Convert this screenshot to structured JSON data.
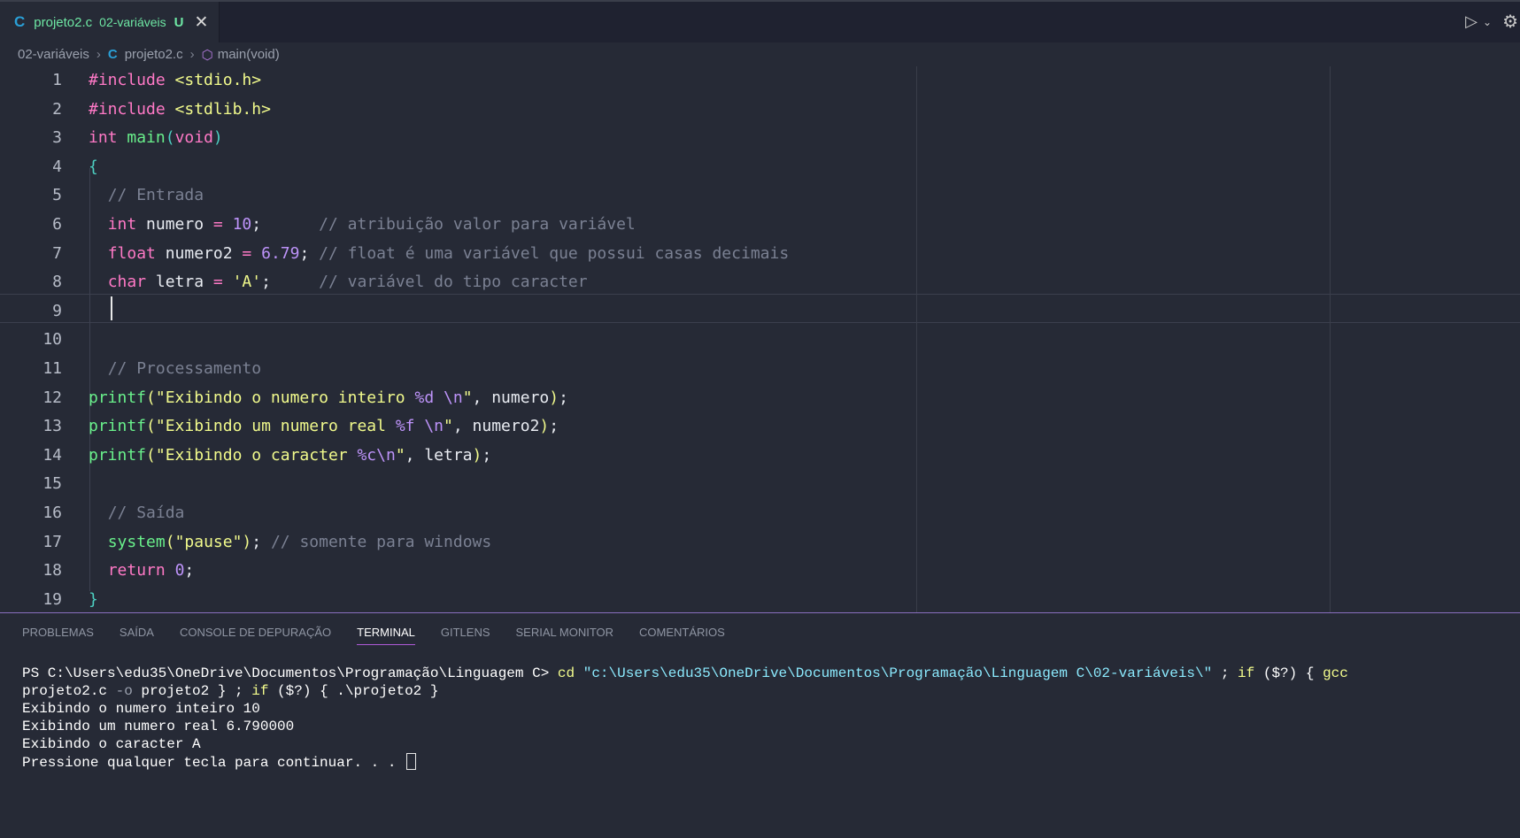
{
  "tab": {
    "icon": "C",
    "filename": "projeto2.c",
    "folder": "02-variáveis",
    "status_badge": "U",
    "close_glyph": "✕"
  },
  "toolbar": {
    "run_icon": "play-icon",
    "chevron_icon": "chevron-down-icon",
    "settings_icon": "gear-icon"
  },
  "breadcrumb": {
    "folder": "02-variáveis",
    "file_icon": "C",
    "file": "projeto2.c",
    "symbol": "main(void)"
  },
  "editor": {
    "current_line": 9,
    "lines": [
      {
        "n": "1",
        "tokens": [
          [
            "kw",
            "#include"
          ],
          [
            "plain",
            " "
          ],
          [
            "str",
            "<stdio.h>"
          ]
        ]
      },
      {
        "n": "2",
        "tokens": [
          [
            "kw",
            "#include"
          ],
          [
            "plain",
            " "
          ],
          [
            "str",
            "<stdlib.h>"
          ]
        ]
      },
      {
        "n": "3",
        "tokens": [
          [
            "kw",
            "int"
          ],
          [
            "plain",
            " "
          ],
          [
            "fn",
            "main"
          ],
          [
            "paren",
            "("
          ],
          [
            "kw",
            "void"
          ],
          [
            "paren",
            ")"
          ]
        ]
      },
      {
        "n": "4",
        "tokens": [
          [
            "paren",
            "{"
          ]
        ]
      },
      {
        "n": "5",
        "tokens": [
          [
            "plain",
            "  "
          ],
          [
            "com",
            "// Entrada"
          ]
        ]
      },
      {
        "n": "6",
        "tokens": [
          [
            "plain",
            "  "
          ],
          [
            "kw",
            "int"
          ],
          [
            "plain",
            " numero "
          ],
          [
            "op",
            "="
          ],
          [
            "plain",
            " "
          ],
          [
            "num",
            "10"
          ],
          [
            "plain",
            ";      "
          ],
          [
            "com",
            "// atribuição valor para variável"
          ]
        ]
      },
      {
        "n": "7",
        "tokens": [
          [
            "plain",
            "  "
          ],
          [
            "kw",
            "float"
          ],
          [
            "plain",
            " numero2 "
          ],
          [
            "op",
            "="
          ],
          [
            "plain",
            " "
          ],
          [
            "num",
            "6.79"
          ],
          [
            "plain",
            "; "
          ],
          [
            "com",
            "// float é uma variável que possui casas decimais"
          ]
        ]
      },
      {
        "n": "8",
        "tokens": [
          [
            "plain",
            "  "
          ],
          [
            "kw",
            "char"
          ],
          [
            "plain",
            " letra "
          ],
          [
            "op",
            "="
          ],
          [
            "plain",
            " "
          ],
          [
            "str",
            "'A'"
          ],
          [
            "plain",
            ";     "
          ],
          [
            "com",
            "// variável do tipo caracter"
          ]
        ]
      },
      {
        "n": "9",
        "tokens": []
      },
      {
        "n": "10",
        "tokens": []
      },
      {
        "n": "11",
        "tokens": [
          [
            "plain",
            "  "
          ],
          [
            "com",
            "// Processamento"
          ]
        ]
      },
      {
        "n": "12",
        "tokens": [
          [
            "fn",
            "printf"
          ],
          [
            "str2",
            "("
          ],
          [
            "str",
            "\"Exibindo o numero inteiro "
          ],
          [
            "esc",
            "%d"
          ],
          [
            "str",
            " "
          ],
          [
            "esc",
            "\\n"
          ],
          [
            "str",
            "\""
          ],
          [
            "plain",
            ", numero"
          ],
          [
            "str2",
            ")"
          ],
          [
            "plain",
            ";"
          ]
        ]
      },
      {
        "n": "13",
        "tokens": [
          [
            "fn",
            "printf"
          ],
          [
            "str2",
            "("
          ],
          [
            "str",
            "\"Exibindo um numero real "
          ],
          [
            "esc",
            "%f"
          ],
          [
            "str",
            " "
          ],
          [
            "esc",
            "\\n"
          ],
          [
            "str",
            "\""
          ],
          [
            "plain",
            ", numero2"
          ],
          [
            "str2",
            ")"
          ],
          [
            "plain",
            ";"
          ]
        ]
      },
      {
        "n": "14",
        "tokens": [
          [
            "fn",
            "printf"
          ],
          [
            "str2",
            "("
          ],
          [
            "str",
            "\"Exibindo o caracter "
          ],
          [
            "esc",
            "%c\\n"
          ],
          [
            "str",
            "\""
          ],
          [
            "plain",
            ", letra"
          ],
          [
            "str2",
            ")"
          ],
          [
            "plain",
            ";"
          ]
        ]
      },
      {
        "n": "15",
        "tokens": []
      },
      {
        "n": "16",
        "tokens": [
          [
            "plain",
            "  "
          ],
          [
            "com",
            "// Saída"
          ]
        ]
      },
      {
        "n": "17",
        "tokens": [
          [
            "plain",
            "  "
          ],
          [
            "fn",
            "system"
          ],
          [
            "str2",
            "("
          ],
          [
            "str",
            "\"pause\""
          ],
          [
            "str2",
            ")"
          ],
          [
            "plain",
            "; "
          ],
          [
            "com",
            "// somente para windows"
          ]
        ]
      },
      {
        "n": "18",
        "tokens": [
          [
            "plain",
            "  "
          ],
          [
            "kw",
            "return"
          ],
          [
            "plain",
            " "
          ],
          [
            "num",
            "0"
          ],
          [
            "plain",
            ";"
          ]
        ]
      },
      {
        "n": "19",
        "tokens": [
          [
            "paren",
            "}"
          ]
        ]
      }
    ]
  },
  "panel": {
    "tabs": [
      "PROBLEMAS",
      "SAÍDA",
      "CONSOLE DE DEPURAÇÃO",
      "TERMINAL",
      "GITLENS",
      "SERIAL MONITOR",
      "COMENTÁRIOS"
    ],
    "active_tab": "TERMINAL"
  },
  "terminal": {
    "prompt": "PS C:\\Users\\edu35\\OneDrive\\Documentos\\Programação\\Linguagem C>",
    "cmd_cd": "cd",
    "cd_path": "\"c:\\Users\\edu35\\OneDrive\\Documentos\\Programação\\Linguagem C\\02-variáveis\\\"",
    "cmd_tail_1": " ; ",
    "kw_if": "if",
    "cond": " ($?) { ",
    "gcc": "gcc",
    "line2_a": "projeto2.c ",
    "flag_o": "-o",
    "line2_b": " projeto2 } ; ",
    "kw_if2": "if",
    "line2_c": " ($?) { .\\projeto2 }",
    "output": [
      "Exibindo o numero inteiro 10",
      "Exibindo um numero real 6.790000",
      "Exibindo o caracter A",
      "Pressione qualquer tecla para continuar. . . "
    ]
  }
}
